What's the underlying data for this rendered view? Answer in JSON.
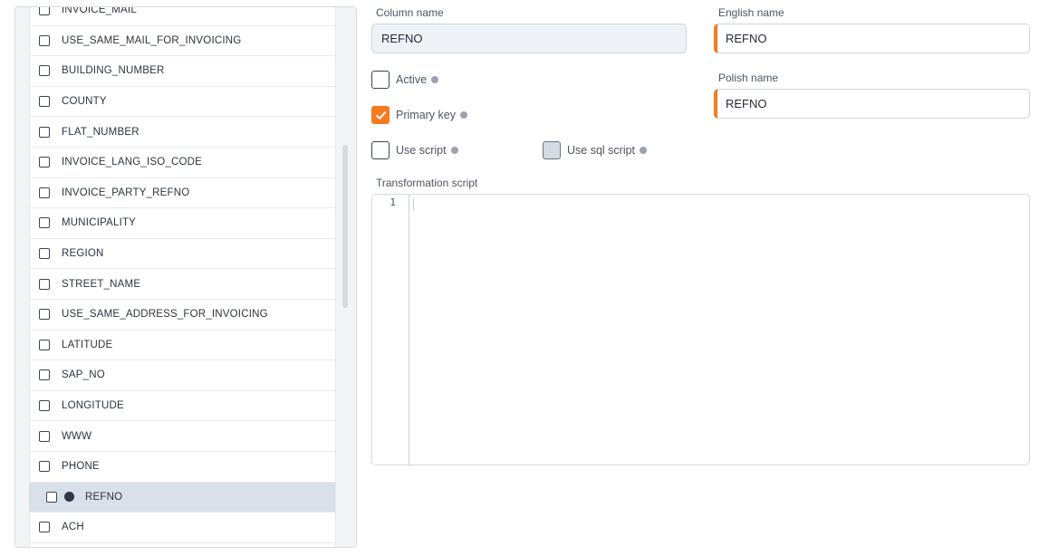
{
  "list": {
    "items": [
      {
        "label": "INVOICE_MAIL",
        "selected": false
      },
      {
        "label": "USE_SAME_MAIL_FOR_INVOICING",
        "selected": false
      },
      {
        "label": "BUILDING_NUMBER",
        "selected": false
      },
      {
        "label": "COUNTY",
        "selected": false
      },
      {
        "label": "FLAT_NUMBER",
        "selected": false
      },
      {
        "label": "INVOICE_LANG_ISO_CODE",
        "selected": false
      },
      {
        "label": "INVOICE_PARTY_REFNO",
        "selected": false
      },
      {
        "label": "MUNICIPALITY",
        "selected": false
      },
      {
        "label": "REGION",
        "selected": false
      },
      {
        "label": "STREET_NAME",
        "selected": false
      },
      {
        "label": "USE_SAME_ADDRESS_FOR_INVOICING",
        "selected": false
      },
      {
        "label": "LATITUDE",
        "selected": false
      },
      {
        "label": "SAP_NO",
        "selected": false
      },
      {
        "label": "LONGITUDE",
        "selected": false
      },
      {
        "label": "WWW",
        "selected": false
      },
      {
        "label": "PHONE",
        "selected": false
      },
      {
        "label": "REFNO",
        "selected": true
      },
      {
        "label": "ACH",
        "selected": false
      }
    ]
  },
  "form": {
    "column_name_label": "Column name",
    "column_name_value": "REFNO",
    "english_name_label": "English name",
    "english_name_value": "REFNO",
    "polish_name_label": "Polish name",
    "polish_name_value": "REFNO",
    "active_label": "Active",
    "active_checked": false,
    "primary_key_label": "Primary key",
    "primary_key_checked": true,
    "use_script_label": "Use script",
    "use_script_checked": false,
    "use_sql_script_label": "Use sql script",
    "use_sql_script_disabled": true,
    "transformation_script_label": "Transformation script",
    "editor_line_number": "1"
  },
  "colors": {
    "accent": "#f47b20",
    "selected_row": "#d9e0ea",
    "info_dot": "#9ca3af"
  }
}
